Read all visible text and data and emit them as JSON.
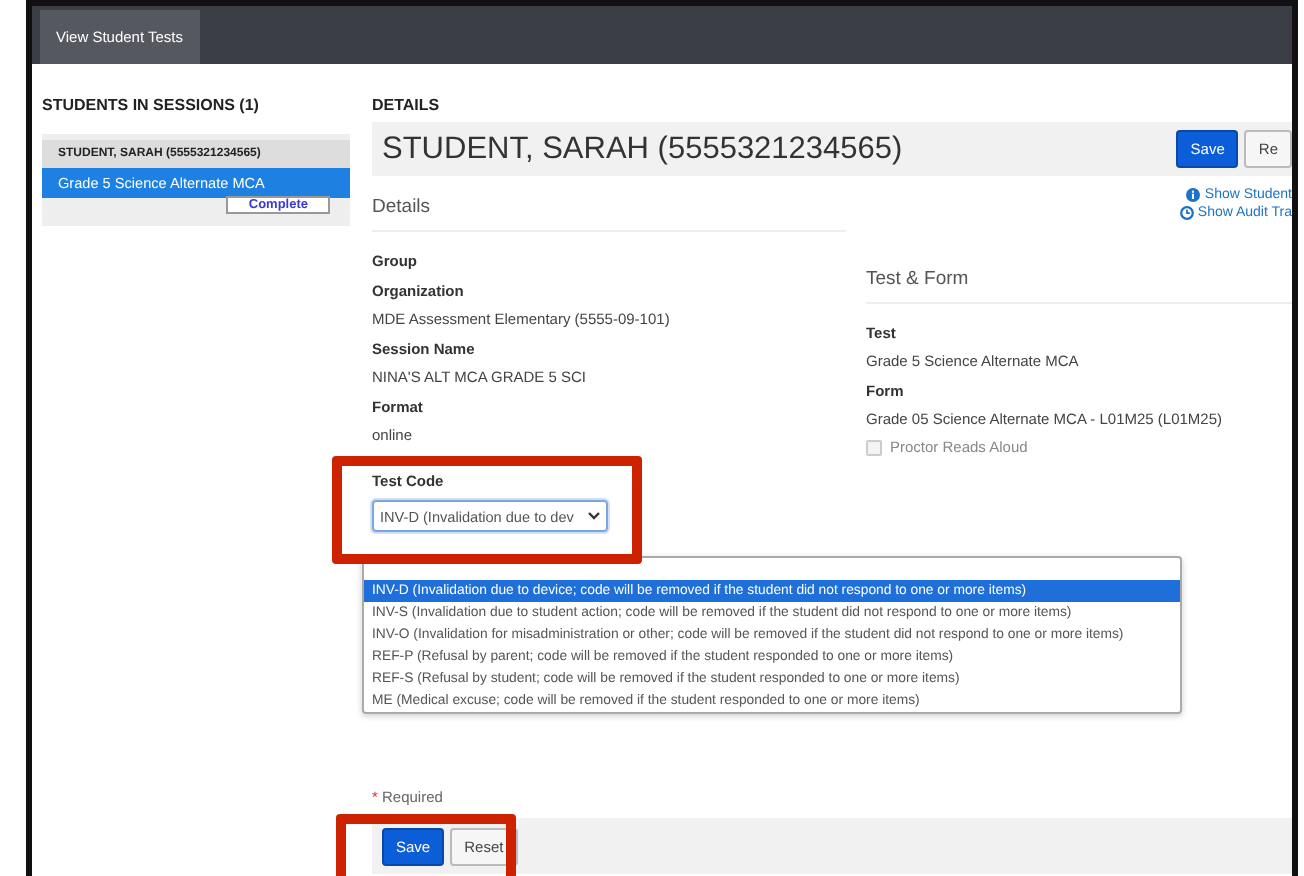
{
  "top_bar": {
    "tabs": [
      {
        "label": "View Student Tests",
        "selected": true
      }
    ]
  },
  "students_panel": {
    "heading": "STUDENTS IN SESSIONS (1)",
    "students": [
      {
        "name": "STUDENT, SARAH (5555321234565)",
        "tests": [
          {
            "name": "Grade 5 Science Alternate MCA",
            "selected": true,
            "status": "Complete"
          }
        ]
      }
    ]
  },
  "details": {
    "heading": "DETAILS",
    "student_name": "STUDENT, SARAH (5555321234565)",
    "header_buttons": [
      {
        "label": "Save",
        "kind": "primary"
      },
      {
        "label": "Re",
        "kind": "default"
      }
    ],
    "section_title": "Details",
    "links": [
      {
        "label": "Show Student",
        "kind": "info"
      },
      {
        "label": "Show Audit Tra",
        "kind": "history"
      }
    ],
    "fields": [
      {
        "label": "Group"
      },
      {
        "label": "Organization",
        "value": "MDE Assessment Elementary (5555-09-101)"
      },
      {
        "label": "Session Name",
        "value": "NINA'S ALT MCA GRADE 5 SCI"
      },
      {
        "label": "Format",
        "value": "online"
      }
    ],
    "test_code": {
      "label": "Test Code",
      "value": "INV-D (Invalidation due to dev",
      "expanded": true,
      "options": [
        {
          "label": "INV-D (Invalidation due to device; code will be removed if the student did not respond to one or more items)",
          "selected": true
        },
        {
          "label": "INV-S (Invalidation due to student action; code will be removed if the student did not respond to one or more items)",
          "selected": false
        },
        {
          "label": "INV-O (Invalidation for misadministration or other; code will be removed if the student did not respond to one or more items)",
          "selected": false
        },
        {
          "label": "REF-P (Refusal by parent; code will be removed if the student responded to one or more items)",
          "selected": false
        },
        {
          "label": "REF-S (Refusal by student; code will be removed if the student responded to one or more items)",
          "selected": false
        },
        {
          "label": "ME (Medical excuse; code will be removed if the student responded to one or more items)",
          "selected": false
        }
      ]
    },
    "test_form": {
      "title": "Test & Form",
      "fields": [
        {
          "label": "Test",
          "value": "Grade 5 Science Alternate MCA"
        },
        {
          "label": "Form",
          "value": "Grade 05 Science Alternate MCA - L01M25 (L01M25)"
        }
      ],
      "checkbox": {
        "label": "Proctor Reads Aloud",
        "checked": false,
        "disabled": true
      }
    },
    "required_marker": "*",
    "required_label": "Required",
    "footer_buttons": [
      {
        "label": "Save",
        "kind": "primary"
      },
      {
        "label": "Reset",
        "kind": "default"
      }
    ]
  }
}
